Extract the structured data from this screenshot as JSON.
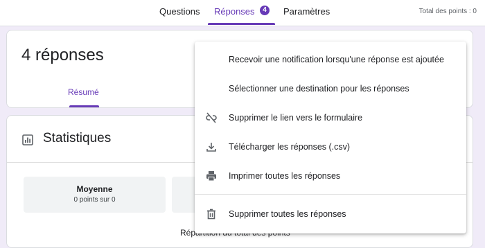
{
  "topbar": {
    "tabs": [
      {
        "label": "Questions"
      },
      {
        "label": "Réponses",
        "badge": "4"
      },
      {
        "label": "Paramètres"
      }
    ],
    "total_points": "Total des points : 0"
  },
  "header": {
    "response_count": "4 réponses",
    "summary_tab": "Résumé"
  },
  "stats": {
    "title": "Statistiques",
    "average_label": "Moyenne",
    "average_value": "0 points sur 0",
    "distribution_title": "Répartition du total des points"
  },
  "menu": {
    "items": [
      {
        "label": "Recevoir une notification lorsqu'une réponse est ajoutée",
        "icon": ""
      },
      {
        "label": "Sélectionner une destination pour les réponses",
        "icon": ""
      },
      {
        "label": "Supprimer le lien vers le formulaire",
        "icon": "link-off-icon"
      },
      {
        "label": "Télécharger les réponses (.csv)",
        "icon": "download-icon"
      },
      {
        "label": "Imprimer toutes les réponses",
        "icon": "print-icon"
      },
      {
        "label": "Supprimer toutes les réponses",
        "icon": "trash-icon"
      }
    ]
  },
  "colors": {
    "accent": "#673ab7",
    "background": "#f0ebf8"
  }
}
